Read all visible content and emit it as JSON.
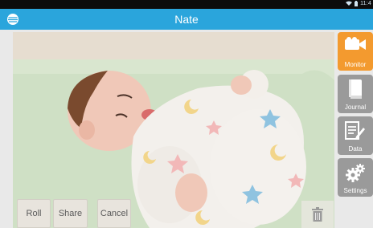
{
  "status": {
    "time": "11:4"
  },
  "header": {
    "title": "Nate"
  },
  "actions": {
    "roll": "Roll",
    "share": "Share",
    "cancel": "Cancel"
  },
  "sidebar": {
    "items": [
      {
        "label": "Monitor",
        "icon": "video-camera-icon",
        "active": true
      },
      {
        "label": "Journal",
        "icon": "book-icon",
        "active": false
      },
      {
        "label": "Data",
        "icon": "chart-pencil-icon",
        "active": false
      },
      {
        "label": "Settings",
        "icon": "gears-icon",
        "active": false
      }
    ]
  },
  "colors": {
    "titlebar": "#2aa5dc",
    "active_tab": "#f39a2f",
    "inactive_tab": "#9a9a9a"
  }
}
